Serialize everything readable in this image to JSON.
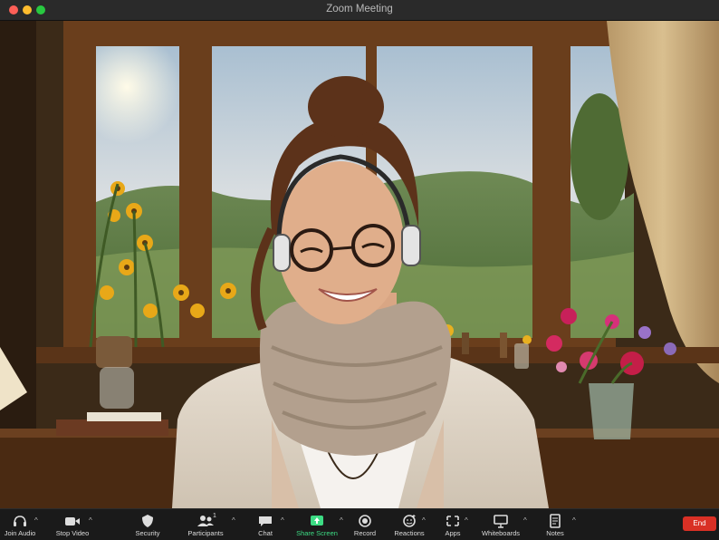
{
  "window": {
    "title": "Zoom Meeting"
  },
  "toolbar": {
    "items": [
      {
        "label": "Join Audio",
        "icon": "headphones-icon"
      },
      {
        "label": "Stop Video",
        "icon": "video-camera-icon"
      },
      {
        "label": "Security",
        "icon": "shield-icon"
      },
      {
        "label": "Participants",
        "icon": "participants-icon",
        "badge": "1"
      },
      {
        "label": "Chat",
        "icon": "chat-bubble-icon"
      },
      {
        "label": "Share Screen",
        "icon": "share-screen-icon"
      },
      {
        "label": "Record",
        "icon": "record-icon"
      },
      {
        "label": "Reactions",
        "icon": "reactions-icon"
      },
      {
        "label": "Apps",
        "icon": "apps-icon"
      },
      {
        "label": "Whiteboards",
        "icon": "whiteboard-icon"
      },
      {
        "label": "Notes",
        "icon": "notes-icon"
      }
    ],
    "end_label": "End",
    "share_color": "#3ddc84",
    "end_color": "#d93025"
  }
}
